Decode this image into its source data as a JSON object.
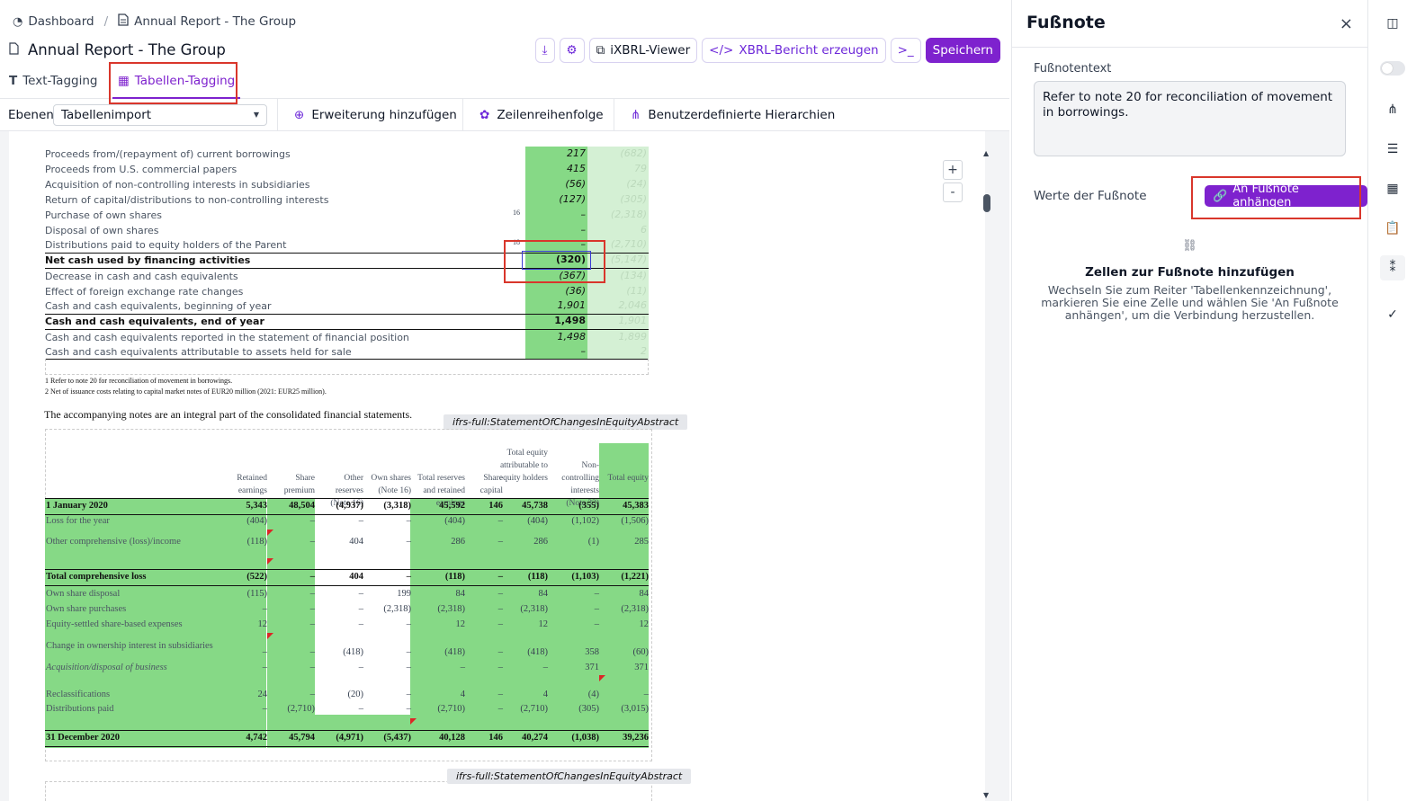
{
  "header": {
    "breadcrumb_home": "Dashboard",
    "breadcrumb_sep": "/",
    "breadcrumb_doc": "Annual Report - The Group",
    "title": "Annual Report - The Group"
  },
  "toolbar": {
    "ixbrl": "iXBRL-Viewer",
    "xbrl": "XBRL-Bericht erzeugen",
    "terminal": ">_",
    "save": "Speichern"
  },
  "tabs": {
    "text": "Text-Tagging",
    "table": "Tabellen-Tagging"
  },
  "options": {
    "layers_label": "Ebenen",
    "layers_value": "Tabellenimport",
    "extension": "Erweiterung hinzufügen",
    "row_order": "Zeilenreihenfolge",
    "hierarchies": "Benutzerdefinierte Hierarchien"
  },
  "zoom": {
    "plus": "+",
    "minus": "-"
  },
  "cashflow": [
    {
      "label": "Proceeds from/(repayment of) current borrowings",
      "value": "217",
      "prior": "(682)"
    },
    {
      "label": "Proceeds from U.S. commercial papers",
      "value": "415",
      "prior": "79"
    },
    {
      "label": "Acquisition of non-controlling interests in subsidiaries",
      "value": "(56)",
      "prior": "(24)"
    },
    {
      "label": "Return of capital/distributions to non-controlling interests",
      "value": "(127)",
      "prior": "(305)"
    },
    {
      "label": "Purchase of own shares",
      "note": "16",
      "value": "–",
      "prior": "(2,318)"
    },
    {
      "label": "Disposal of own shares",
      "value": "–",
      "prior": "6"
    },
    {
      "label": "Distributions paid to equity holders of the Parent",
      "note": "18",
      "value": "–",
      "prior": "(2,710)"
    },
    {
      "label": "Net cash used by financing activities",
      "value": "(320)",
      "prior": "(5,147)",
      "bold": true
    },
    {
      "label": "Decrease in cash and cash equivalents",
      "value": "(367)",
      "prior": "(134)"
    },
    {
      "label": "Effect of foreign exchange rate changes",
      "value": "(36)",
      "prior": "(11)"
    },
    {
      "label": "Cash and cash equivalents, beginning of year",
      "value": "1,901",
      "prior": "2,046"
    },
    {
      "label": "Cash and cash equivalents, end of year",
      "value": "1,498",
      "prior": "1,901",
      "bold": true
    },
    {
      "label": "Cash and cash equivalents reported in the statement of financial position",
      "value": "1,498",
      "prior": "1,899"
    },
    {
      "label": "Cash and cash equivalents attributable to assets held for sale",
      "value": "–",
      "prior": "2"
    }
  ],
  "footnotes": [
    "1   Refer to note 20 for reconciliation of movement in borrowings.",
    "2   Net of issuance costs relating to capital market notes of EUR20 million (2021: EUR25 million)."
  ],
  "notes_statement": "The accompanying notes are an integral part of the consolidated financial statements.",
  "concept_tag": "ifrs-full:StatementOfChangesInEquityAbstract",
  "equity": {
    "headers": [
      "Retained earnings",
      "Share premium",
      "Other reserves (Note 16)",
      "Own shares (Note 16)",
      "Total reserves and retained earnings",
      "Share capital",
      "Total equity attributable to equity holders",
      "Non-controlling interests (Note 33)",
      "Total equity"
    ],
    "rows": [
      {
        "label": "1 January 2020",
        "bold": true,
        "vals": [
          "5,343",
          "48,504",
          "(4,937)",
          "(3,318)",
          "45,592",
          "146",
          "45,738",
          "(355)",
          "45,383"
        ]
      },
      {
        "label": "Loss for the year",
        "vals": [
          "(404)",
          "–",
          "–",
          "–",
          "(404)",
          "–",
          "(404)",
          "(1,102)",
          "(1,506)"
        ]
      },
      {
        "label": "Other comprehensive (loss)/income",
        "vals": [
          "(118)",
          "–",
          "404",
          "–",
          "286",
          "–",
          "286",
          "(1)",
          "285"
        ]
      },
      {
        "label": "Total comprehensive loss",
        "bold": true,
        "vals": [
          "(522)",
          "–",
          "404",
          "–",
          "(118)",
          "–",
          "(118)",
          "(1,103)",
          "(1,221)"
        ]
      },
      {
        "label": "Own share disposal",
        "vals": [
          "(115)",
          "–",
          "–",
          "199",
          "84",
          "–",
          "84",
          "–",
          "84"
        ]
      },
      {
        "label": "Own share purchases",
        "vals": [
          "–",
          "–",
          "–",
          "(2,318)",
          "(2,318)",
          "–",
          "(2,318)",
          "–",
          "(2,318)"
        ]
      },
      {
        "label": "Equity-settled share-based expenses",
        "vals": [
          "12",
          "–",
          "–",
          "–",
          "12",
          "–",
          "12",
          "–",
          "12"
        ]
      },
      {
        "label": "Change in ownership interest in subsidiaries",
        "vals": [
          "–",
          "–",
          "(418)",
          "–",
          "(418)",
          "–",
          "(418)",
          "358",
          "(60)"
        ]
      },
      {
        "label": "Acquisition/disposal of business",
        "vals": [
          "–",
          "–",
          "–",
          "–",
          "–",
          "–",
          "–",
          "371",
          "371"
        ]
      },
      {
        "label": "Reclassifications",
        "vals": [
          "24",
          "–",
          "(20)",
          "–",
          "4",
          "–",
          "4",
          "(4)",
          "–"
        ]
      },
      {
        "label": "Distributions paid",
        "vals": [
          "–",
          "(2,710)",
          "–",
          "–",
          "(2,710)",
          "–",
          "(2,710)",
          "(305)",
          "(3,015)"
        ]
      },
      {
        "label": "31 December 2020",
        "bold": true,
        "vals": [
          "4,742",
          "45,794",
          "(4,971)",
          "(5,437)",
          "40,128",
          "146",
          "40,274",
          "(1,038)",
          "39,236"
        ]
      }
    ]
  },
  "sidebar": {
    "title": "Fußnote",
    "close": "×",
    "text_label": "Fußnotentext",
    "text_value": "Refer to note 20 for reconciliation of movement in borrowings.",
    "values_label": "Werte der Fußnote",
    "attach": "An Fußnote anhängen",
    "empty_title": "Zellen zur Fußnote hinzufügen",
    "empty_desc": "Wechseln Sie zum Reiter 'Tabellenkennzeichnung', markieren Sie eine Zelle und wählen Sie 'An Fußnote anhängen', um die Verbindung herzustellen."
  },
  "colors": {
    "accent": "#7e22ce",
    "tagged": "#86d986",
    "tagged_light": "#d4f0d4",
    "highlight_box": "#d9362b"
  }
}
